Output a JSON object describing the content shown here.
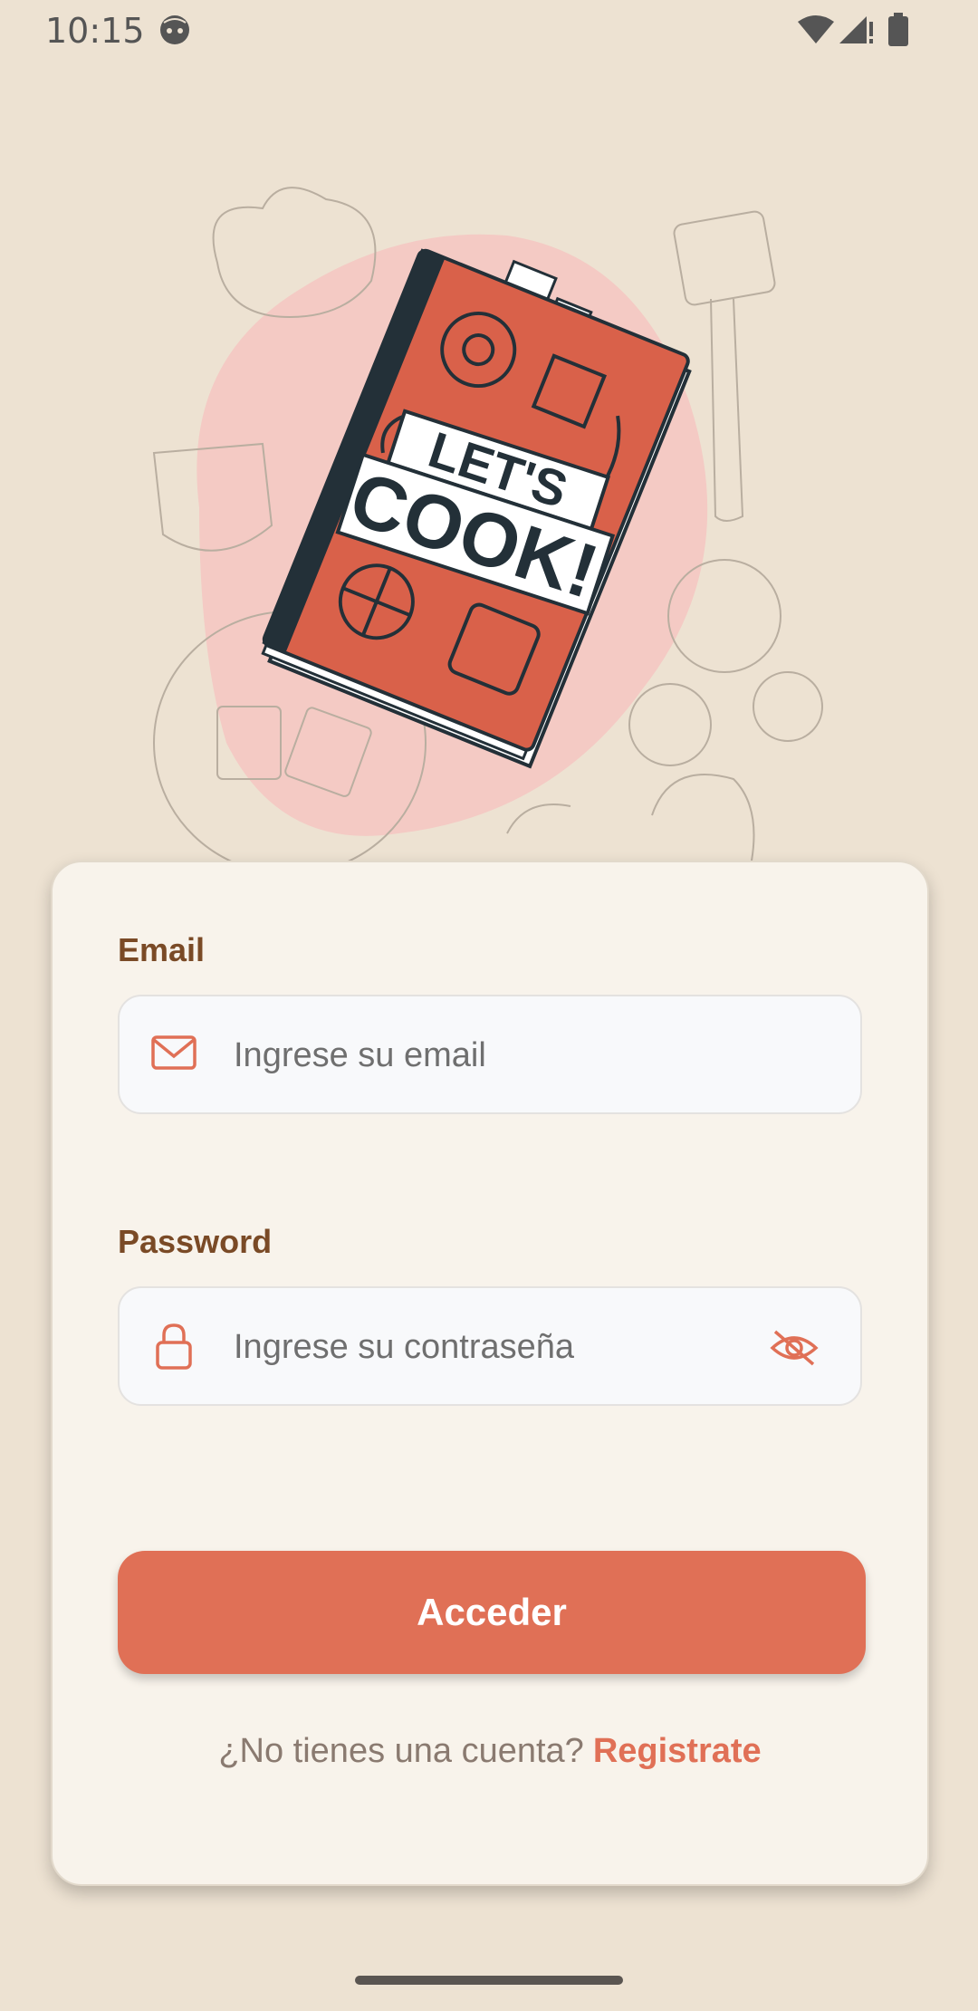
{
  "status_bar": {
    "time": "10:15"
  },
  "hero": {
    "book_line1": "LET'S",
    "book_line2": "COOK!"
  },
  "form": {
    "email_label": "Email",
    "email_placeholder": "Ingrese su email",
    "password_label": "Password",
    "password_placeholder": "Ingrese su contraseña",
    "submit_label": "Acceder",
    "signup_prompt": "¿No tienes una cuenta?",
    "signup_link": "Registrate"
  },
  "colors": {
    "accent": "#e07056",
    "label": "#7a4a26",
    "background": "#ede2d2",
    "card": "#f8f3eb"
  }
}
